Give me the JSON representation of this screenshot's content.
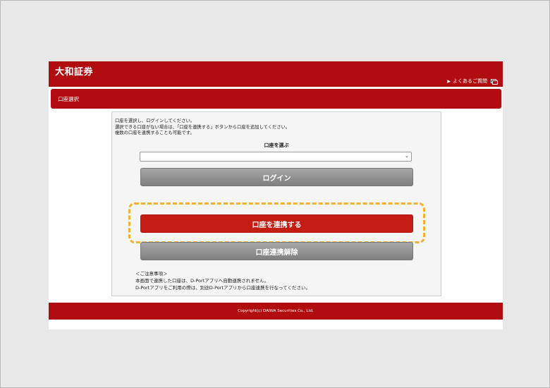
{
  "header": {
    "brand": "大和証券",
    "faq_link": "よくあるご質問"
  },
  "title_bar": {
    "title": "口座選択"
  },
  "panel": {
    "instructions": [
      "口座を選択し、ログインしてください。",
      "選択できる口座がない場合は、「口座を連携する」ボタンから口座を追加してください。",
      "複数の口座を連携することも可能です。"
    ],
    "select_label": "口座を選ぶ",
    "select_value": "",
    "login_button": "ログイン",
    "link_account_button": "口座を連携する",
    "unlink_account_button": "口座連携解除",
    "notes": [
      "＜ご注意事項＞",
      "本画面で連携した口座は、D-Portアプリへ自動連携されません。",
      "D-Portアプリをご利用の際は、別途D-Portアプリから口座連携を行なってください。"
    ]
  },
  "footer": {
    "copyright": "Copyright(c) DAIWA Securities Co., Ltd."
  },
  "colors": {
    "brand_red": "#b10d10",
    "button_red": "#c41e14",
    "button_gray": "#8f8f8f",
    "highlight": "#f4b234"
  },
  "icons": {
    "faq_arrow": "triangle-right-icon",
    "faq_window": "new-window-icon",
    "select_chevron": "chevron-down-icon"
  }
}
